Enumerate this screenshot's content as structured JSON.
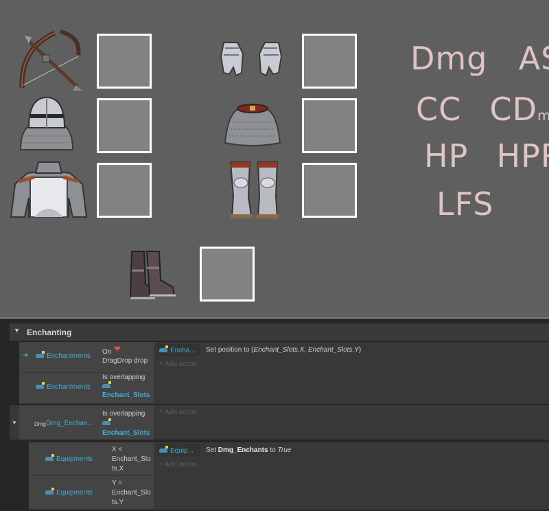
{
  "handwriting": {
    "row1": [
      "Dmg",
      "AS"
    ],
    "row2_a": "CC",
    "row2_b_main": "CD",
    "row2_b_sub": "mg",
    "row3": [
      "HP",
      "HPR"
    ],
    "row4": "LFS"
  },
  "equipment": [
    "crossbow-icon",
    "gauntlets-icon",
    "knight-helmet-icon",
    "chainmail-coif-icon",
    "chest-armor-icon",
    "leg-greaves-icon",
    "boots-icon"
  ],
  "events": {
    "group_title": "Enchanting",
    "e1": {
      "c1_object": "Enchantments",
      "c1_text_a": "On",
      "c1_text_b": "DragDrop drop",
      "c2_object": "Enchantments",
      "c2_text": "Is overlapping",
      "c2_target": "Enchant_Slots",
      "action_object": "Encha...",
      "action_text_pre": "Set position to (",
      "action_text_args": "Enchant_Slots.X, Enchant_Slots.Y",
      "action_text_post": ")",
      "add_action": "+ Add action"
    },
    "e2": {
      "object_prefix": "Dmg",
      "object": "Dmg_Enchan...",
      "text": "Is overlapping",
      "target": "Enchant_Slots",
      "add_action": "+ Add action"
    },
    "e3": {
      "c1_object": "Equipments",
      "c1_lines": [
        "X <",
        "Enchant_Slo",
        "ts.X"
      ],
      "c2_object": "Equipments",
      "c2_lines": [
        "Y =",
        "Enchant_Slo",
        "ts.Y"
      ],
      "action_object": "Equip...",
      "action_set": "Set",
      "action_var": "Dmg_Enchants",
      "action_to": "to",
      "action_val": "True",
      "add_action": "+ Add action"
    }
  },
  "colors": {
    "scene_bg": "#5f5f5f",
    "slot_fill": "#828282",
    "slot_border": "#ffffff",
    "handwriting": "#e0c3c3",
    "object_link": "#3fb0d8"
  }
}
